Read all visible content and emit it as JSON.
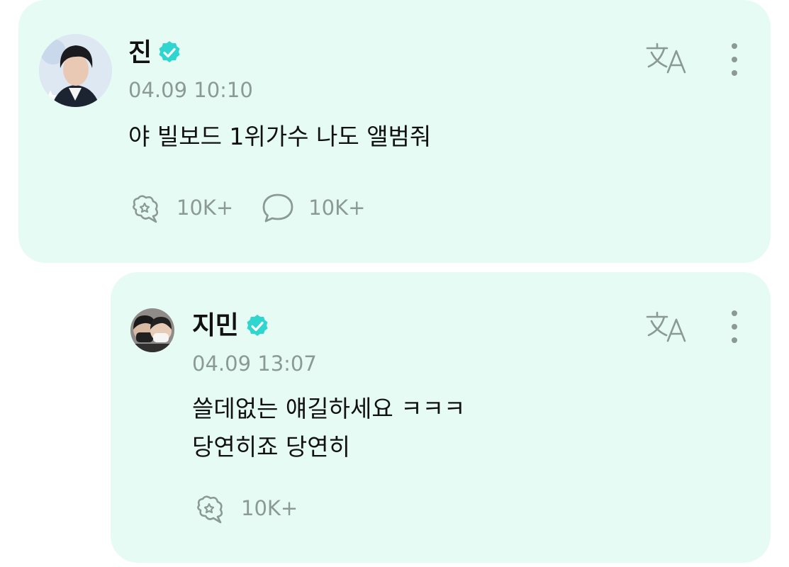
{
  "post": {
    "author": "진",
    "timestamp": "04.09 10:10",
    "body": "야 빌보드 1위가수 나도 앨범줘",
    "likes": "10K+",
    "comments": "10K+"
  },
  "reply": {
    "author": "지민",
    "timestamp": "04.09 13:07",
    "body": "쓸데없는 얘길하세요 ㅋㅋㅋ\n당연히죠 당연히",
    "likes": "10K+"
  },
  "colors": {
    "card_bg": "#e7fbf5",
    "verified": "#2fd6cf",
    "muted": "#8c9a96"
  }
}
